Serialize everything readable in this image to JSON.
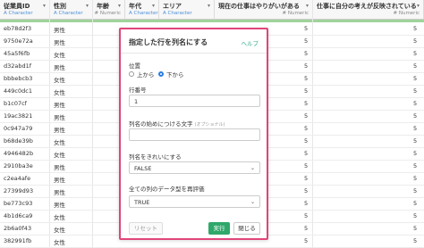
{
  "columns": [
    {
      "name": "従業員ID",
      "type": "Character"
    },
    {
      "name": "性別",
      "type": "Character"
    },
    {
      "name": "年齢",
      "type": "Numeric"
    },
    {
      "name": "年代",
      "type": "Character"
    },
    {
      "name": "エリア",
      "type": "Character"
    },
    {
      "name": "現在の仕事はやりがいがある",
      "type": "Numeric"
    },
    {
      "name": "仕事に自分の考えが反映されている",
      "type": "Numeric"
    }
  ],
  "rows": [
    {
      "id": "eb78d2f3",
      "gender": "男性",
      "v1": "5",
      "v2": "5"
    },
    {
      "id": "9750e72a",
      "gender": "男性",
      "v1": "5",
      "v2": "5"
    },
    {
      "id": "45a5f6fb",
      "gender": "女性",
      "v1": "5",
      "v2": "5"
    },
    {
      "id": "d32abd1f",
      "gender": "男性",
      "v1": "5",
      "v2": "5"
    },
    {
      "id": "bbbebcb3",
      "gender": "女性",
      "v1": "5",
      "v2": "5"
    },
    {
      "id": "449c0dc1",
      "gender": "女性",
      "v1": "5",
      "v2": "5"
    },
    {
      "id": "b1c07cf",
      "gender": "男性",
      "v1": "5",
      "v2": "5"
    },
    {
      "id": "19ac3821",
      "gender": "男性",
      "v1": "5",
      "v2": "5"
    },
    {
      "id": "0c947a79",
      "gender": "男性",
      "v1": "5",
      "v2": "5"
    },
    {
      "id": "b68de39b",
      "gender": "女性",
      "v1": "5",
      "v2": "5"
    },
    {
      "id": "4946482b",
      "gender": "女性",
      "v1": "5",
      "v2": "5"
    },
    {
      "id": "2910ba3e",
      "gender": "男性",
      "v1": "5",
      "v2": "5"
    },
    {
      "id": "c2ea4afe",
      "gender": "男性",
      "v1": "5",
      "v2": "5"
    },
    {
      "id": "27399d93",
      "gender": "男性",
      "v1": "5",
      "v2": "5"
    },
    {
      "id": "be773c93",
      "gender": "男性",
      "v1": "5",
      "v2": "5"
    },
    {
      "id": "4b1d6ca9",
      "gender": "女性",
      "v1": "5",
      "v2": "5"
    },
    {
      "id": "2b6a0f43",
      "gender": "女性",
      "v1": "5",
      "v2": "5"
    },
    {
      "id": "382991fb",
      "gender": "女性",
      "v1": "5",
      "v2": "5"
    }
  ],
  "dialog": {
    "title": "指定した行を列名にする",
    "help": "ヘルプ",
    "position_label": "位置",
    "radio_above": "上から",
    "radio_below": "下から",
    "row_number_label": "行番号",
    "row_number_value": "1",
    "prefix_label": "列名の始めにつける文字",
    "prefix_optional": "(オプショナル)",
    "prefix_value": "",
    "clean_names_label": "列名をきれいにする",
    "clean_names_value": "FALSE",
    "reeval_label": "全ての列のデータ型を再評価",
    "reeval_value": "TRUE",
    "reset": "リセット",
    "execute": "実行",
    "close": "閉じる"
  },
  "colors": {
    "accent": "#e0457b",
    "execute": "#2fa86a",
    "help": "#2bab8a",
    "type_char": "#4a8fd8"
  }
}
